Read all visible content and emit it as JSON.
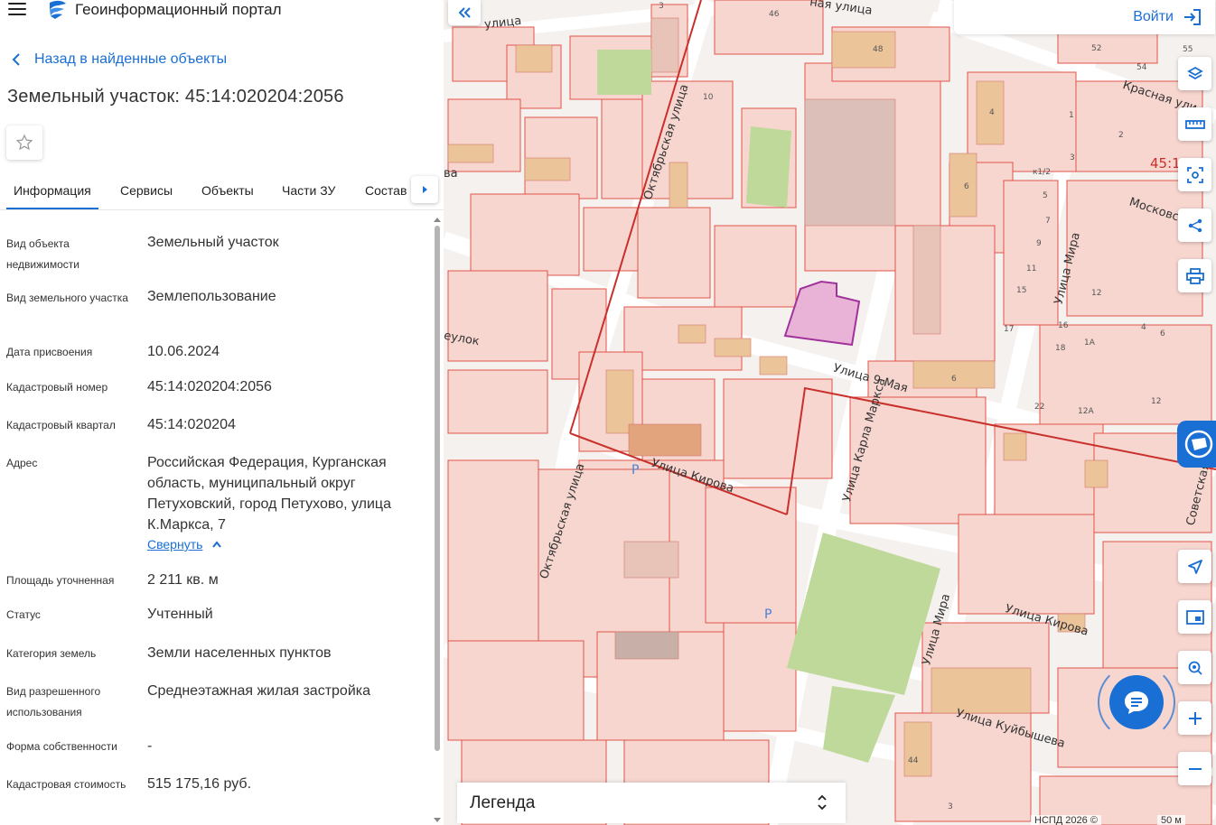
{
  "header": {
    "portal_title": "Геоинформационный портал",
    "menu_icon": "hamburger-icon",
    "logo_icon": "portal-logo-icon"
  },
  "panel": {
    "back_label": "Назад в найденные объекты",
    "title": "Земельный участок: 45:14:020204:2056",
    "tabs": [
      {
        "label": "Информация",
        "active": true
      },
      {
        "label": "Сервисы"
      },
      {
        "label": "Объекты"
      },
      {
        "label": "Части ЗУ"
      },
      {
        "label": "Состав"
      }
    ],
    "properties": [
      {
        "label": "Вид объекта недвижимости",
        "value": "Земельный участок"
      },
      {
        "label": "Вид земельного участка",
        "value": "Землепользование"
      },
      {
        "label": "Дата присвоения",
        "value": "10.06.2024"
      },
      {
        "label": "Кадастровый номер",
        "value": "45:14:020204:2056"
      },
      {
        "label": "Кадастровый квартал",
        "value": "45:14:020204"
      },
      {
        "label": "Адрес",
        "value": "Российская Федерация, Курганская область, муниципальный округ Петуховский, город Петухово, улица К.Маркса, 7"
      },
      {
        "label": "Площадь уточненная",
        "value": "2 211 кв. м"
      },
      {
        "label": "Статус",
        "value": "Учтенный"
      },
      {
        "label": "Категория земель",
        "value": "Земли населенных пунктов"
      },
      {
        "label": "Вид разрешенного использования",
        "value": "Среднеэтажная жилая застройка"
      },
      {
        "label": "Форма собственности",
        "value": "-"
      },
      {
        "label": "Кадастровая стоимость",
        "value": "515 175,16 руб."
      }
    ],
    "collapse_label": "Свернуть"
  },
  "map": {
    "login_label": "Войти",
    "legend_label": "Легенда",
    "attribution": "НСПД 2026 ©",
    "scale_label": "50 м",
    "street_labels": [
      "улица",
      "ная улица",
      "Красная ули",
      "Московс",
      "Октябрьская улица",
      "Улица Мира",
      "Улица 9 Мая",
      "еулок",
      "Улица Кирова",
      "Улица Карла Маркса",
      "Октябрьская улица",
      "Советская",
      "Улица Мира",
      "Улица Кирова",
      "Улица Куйбышева",
      "ва",
      "45:1"
    ],
    "building_numbers": [
      "3",
      "46",
      "48",
      "52",
      "54",
      "55",
      "10",
      "4",
      "1",
      "2",
      "3",
      "к1/2",
      "5",
      "6",
      "7",
      "9",
      "11",
      "15",
      "16",
      "17",
      "18",
      "1А",
      "12",
      "4",
      "6",
      "6",
      "22",
      "12А",
      "12",
      "44",
      "3"
    ],
    "parking_label": "P",
    "colors": {
      "parcel_fill": "#f7d6cf",
      "parcel_stroke": "#e2544b",
      "selected_fill": "#e6a8d2",
      "selected_stroke": "#a0329b",
      "road": "#ffffff",
      "green": "#bfd99a",
      "accent": "#1a6fd4"
    }
  }
}
